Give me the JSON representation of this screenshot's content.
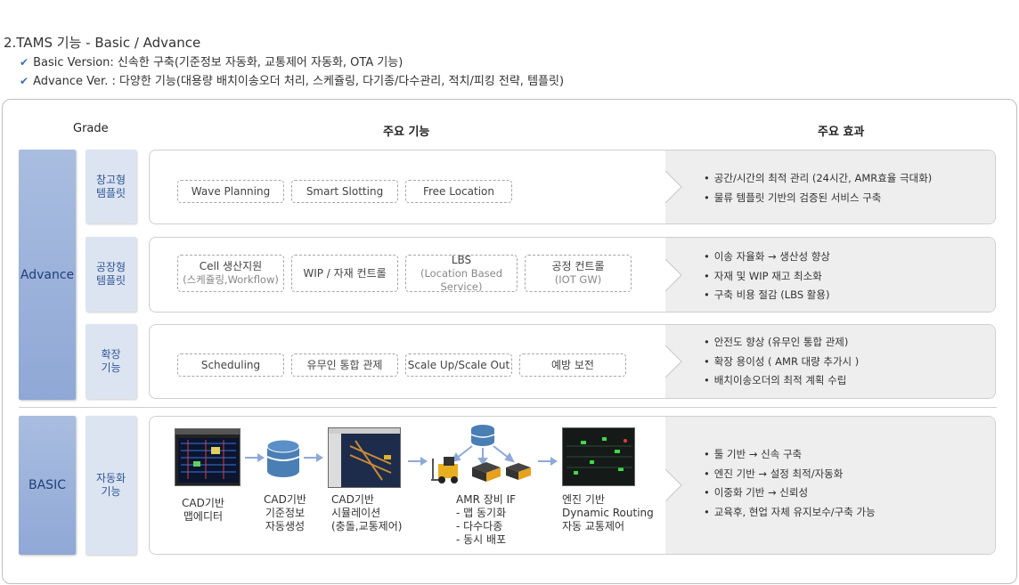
{
  "header": {
    "title": "2.TAMS 기능 - Basic / Advance",
    "bullets": [
      "Basic Version: 신속한 구축(기준정보 자동화, 교통제어 자동화, OTA 기능)",
      "Advance Ver. : 다양한 기능(대용량 배치이송오더 처리, 스케쥴링, 다기종/다수관리, 적치/피킹 전략, 템플릿)"
    ]
  },
  "columns": {
    "grade": "Grade",
    "functions": "주요 기능",
    "effects": "주요 효과"
  },
  "grades": {
    "advance": "Advance",
    "basic": "BASIC"
  },
  "rows": {
    "warehouse": {
      "label": "창고형\n템플릿",
      "features": [
        "Wave Planning",
        "Smart Slotting",
        "Free Location"
      ],
      "effects": [
        "공간/시간의 최적 관리 (24시간, AMR효율 극대화)",
        "물류 템플릿 기반의 검증된 서비스 구축"
      ]
    },
    "factory": {
      "label": "공장형\n템플릿",
      "features": [
        {
          "main": "Cell 생산지원",
          "sub": "(스케쥴링,Workflow)"
        },
        {
          "main": "WIP / 자재 컨트롤",
          "sub": ""
        },
        {
          "main": "LBS",
          "sub": "(Location Based Service)"
        },
        {
          "main": "공정 컨트롤",
          "sub": "(IOT GW)"
        }
      ],
      "effects": [
        "이송 자율화 → 생산성 향상",
        "자재 및 WIP 재고 최소화",
        "구축 비용 절감 (LBS 활용)"
      ]
    },
    "extension": {
      "label": "확장\n기능",
      "features": [
        "Scheduling",
        "유무인 통합 관제",
        "Scale Up/Scale Out",
        "예방 보전"
      ],
      "effects": [
        "안전도 향상 (유무인 통합 관제)",
        "확장 용이성 ( AMR 대량 추가시 )",
        "배치이송오더의 최적 계획 수립"
      ]
    },
    "auto": {
      "label": "자동화\n기능",
      "steps": [
        {
          "lines": [
            "CAD기반",
            "맵에디터"
          ]
        },
        {
          "lines": [
            "CAD기반",
            "기준정보",
            "자동생성"
          ]
        },
        {
          "lines": [
            "CAD기반",
            "시뮬레이션",
            "(충돌,교통제어)"
          ]
        },
        {
          "lines": [
            "AMR 장비 IF",
            "- 맵 동기화",
            "- 다수다종",
            "- 동시 배포"
          ]
        },
        {
          "lines": [
            "엔진 기반",
            "Dynamic Routing",
            "자동 교통제어"
          ]
        }
      ],
      "effects": [
        "툴 기반 → 신속 구축",
        "엔진 기반 → 설정 최적/자동화",
        "이중화 기반 → 신뢰성",
        "교육후, 현업 자체 유지보수/구축 가능"
      ]
    }
  },
  "icons": [
    "check-icon",
    "database-icon",
    "forklift-icon",
    "amr-robot-icon",
    "arrow-right-icon"
  ],
  "colors": {
    "grade_bg": "#8fa8d5",
    "sub_bg": "#dce4f1",
    "effect_bg": "#eeeeee",
    "accent": "#3b6fb5"
  }
}
